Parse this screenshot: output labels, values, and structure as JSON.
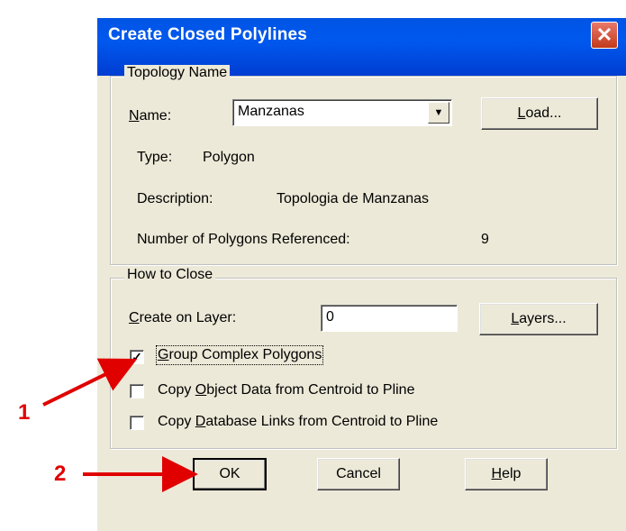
{
  "dialog": {
    "title": "Create Closed Polylines",
    "close_glyph": "✕"
  },
  "topology": {
    "group_label": "Topology Name",
    "name_label": "Name:",
    "name_value": "Manzanas",
    "load_button": "Load...",
    "type_label": "Type:",
    "type_value": "Polygon",
    "description_label": "Description:",
    "description_value": "Topologia de Manzanas",
    "polygons_label": "Number of Polygons Referenced:",
    "polygons_value": "9"
  },
  "how_to_close": {
    "group_label": "How to Close",
    "layer_label": "Create on Layer:",
    "layer_value": "0",
    "layers_button": "Layers...",
    "options": [
      {
        "label": "Group Complex Polygons",
        "checked": true
      },
      {
        "label": "Copy Object Data from Centroid to Pline",
        "checked": false
      },
      {
        "label": "Copy Database Links from Centroid to Pline",
        "checked": false
      }
    ]
  },
  "buttons": {
    "ok": "OK",
    "cancel": "Cancel",
    "help": "Help"
  },
  "annotations": {
    "marker_1": "1",
    "marker_2": "2",
    "arrow_color": "#e00000"
  },
  "icons": {
    "dropdown": "chevron-down-icon",
    "close": "close-icon",
    "check": "checkmark-icon"
  }
}
